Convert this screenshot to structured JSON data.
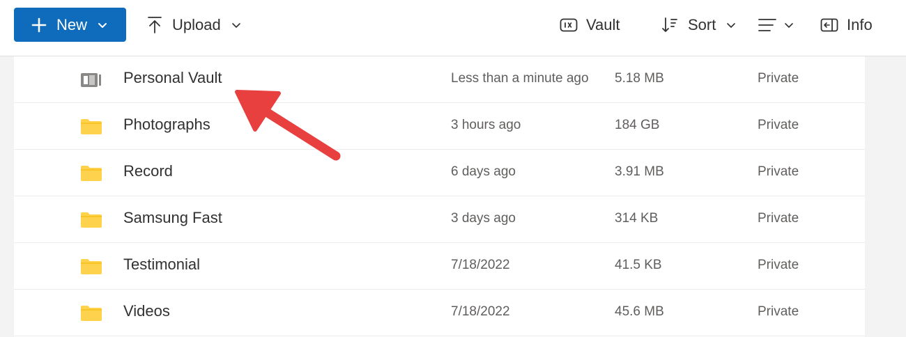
{
  "toolbar": {
    "new_label": "New",
    "upload_label": "Upload",
    "vault_label": "Vault",
    "sort_label": "Sort",
    "info_label": "Info"
  },
  "files": [
    {
      "name": "Personal Vault",
      "modified": "Less than a minute ago",
      "size": "5.18 MB",
      "sharing": "Private",
      "icon": "vault-icon"
    },
    {
      "name": "Photographs",
      "modified": "3 hours ago",
      "size": "184 GB",
      "sharing": "Private",
      "icon": "folder-icon"
    },
    {
      "name": "Record",
      "modified": "6 days ago",
      "size": "3.91 MB",
      "sharing": "Private",
      "icon": "folder-icon"
    },
    {
      "name": "Samsung Fast",
      "modified": "3 days ago",
      "size": "314 KB",
      "sharing": "Private",
      "icon": "folder-icon"
    },
    {
      "name": "Testimonial",
      "modified": "7/18/2022",
      "size": "41.5 KB",
      "sharing": "Private",
      "icon": "folder-icon"
    },
    {
      "name": "Videos",
      "modified": "7/18/2022",
      "size": "45.6 MB",
      "sharing": "Private",
      "icon": "folder-icon"
    }
  ],
  "colors": {
    "accent": "#0f6cbd",
    "folder": "#ffd24d",
    "annotation_arrow": "#e8403f"
  }
}
